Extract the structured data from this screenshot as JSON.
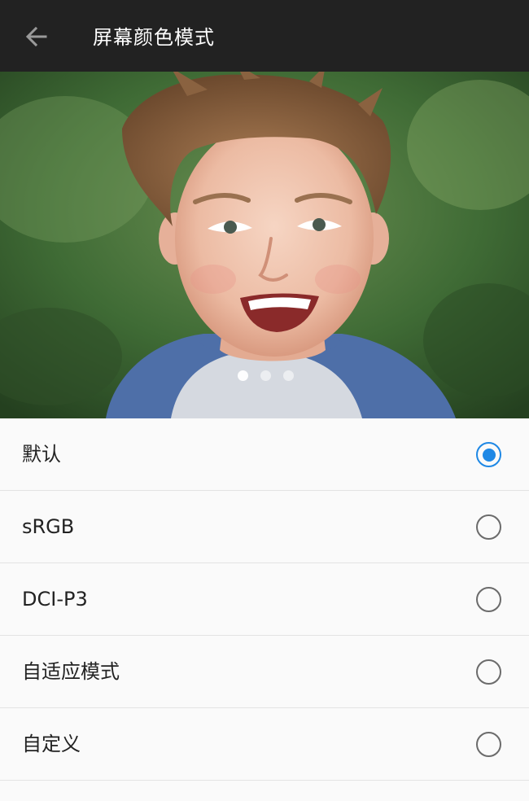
{
  "header": {
    "title": "屏幕颜色模式",
    "back_icon": "arrow-left-icon"
  },
  "preview": {
    "image": "smiling-child-photo",
    "pager": {
      "count": 3,
      "active_index": 0
    }
  },
  "options": [
    {
      "label": "默认",
      "selected": true
    },
    {
      "label": "sRGB",
      "selected": false
    },
    {
      "label": "DCI-P3",
      "selected": false
    },
    {
      "label": "自适应模式",
      "selected": false
    },
    {
      "label": "自定义",
      "selected": false
    }
  ],
  "colors": {
    "appbar": "#222222",
    "accent": "#1e88e5",
    "background": "#fafafa"
  }
}
